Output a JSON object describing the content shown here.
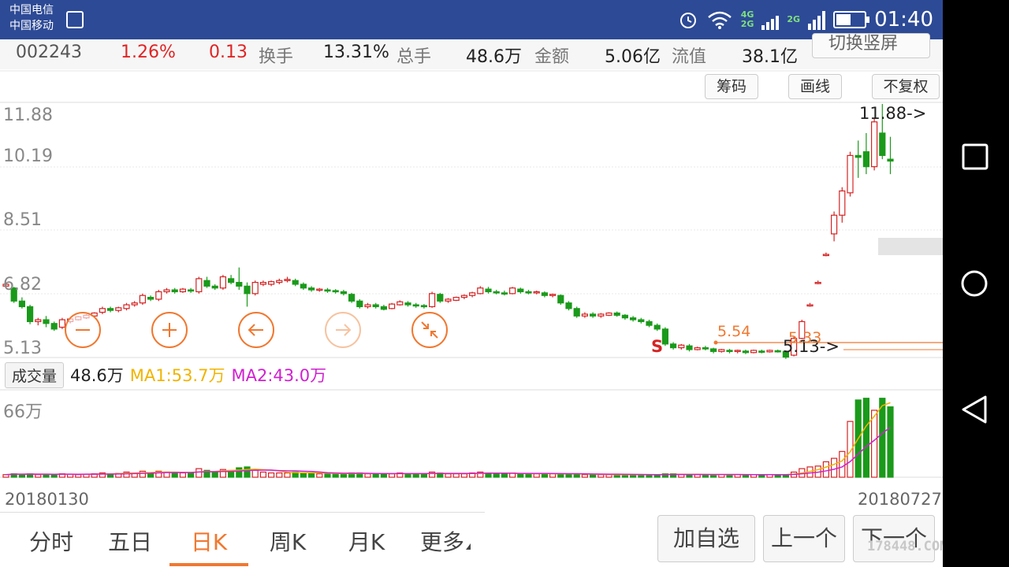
{
  "status_bar": {
    "carrier_1": "中国电信",
    "carrier_2": "中国移动",
    "net_1": "4G",
    "net_2": "2G",
    "net_3": "2G",
    "time": "01:40"
  },
  "quote": {
    "code": "002243",
    "change_pct": "1.26%",
    "change": "0.13",
    "turnover_label": "换手",
    "turnover": "13.31%",
    "volume_label": "总手",
    "volume": "48.6万",
    "amount_label": "金额",
    "amount": "5.06亿",
    "float_label": "流值",
    "float_value": "38.1亿",
    "switch_button": "切换竖屏"
  },
  "toolbar": {
    "chips": "筹码",
    "draw": "画线",
    "adjust": "不复权"
  },
  "chart": {
    "y_ticks": [
      "11.88",
      "10.19",
      "8.51",
      "6.82",
      "5.13"
    ],
    "high_marker": "11.88->",
    "low_marker": "5.13->",
    "avg_label_1": "5.54",
    "avg_label_2": "5.33",
    "signal": "S"
  },
  "volume_header": {
    "tag": "成交量",
    "value": "48.6万",
    "ma1": "MA1:53.7万",
    "ma2": "MA2:43.0万",
    "max_label": "66万"
  },
  "dates": {
    "start": "20180130",
    "end": "20180727"
  },
  "tabs": [
    "分时",
    "五日",
    "日K",
    "周K",
    "月K",
    "更多"
  ],
  "active_tab": "日K",
  "buttons": {
    "add_watch": "加自选",
    "prev": "上一个",
    "next": "下一个"
  },
  "watermark": "178448.COM",
  "colors": {
    "up": "#d42424",
    "down": "#1a9a1a",
    "accent": "#f07830",
    "status_bar": "#2d4a96",
    "ma1": "#f0b400",
    "ma2": "#d020d0"
  },
  "chart_data": {
    "type": "candlestick",
    "y_range": [
      5.13,
      11.88
    ],
    "volume_max": "66万",
    "price_axis": [
      5.13,
      6.82,
      8.51,
      10.19,
      11.88
    ],
    "candles": [
      [
        7.0,
        7.1,
        7.05,
        6.95
      ],
      [
        6.95,
        6.98,
        6.6,
        6.55
      ],
      [
        6.6,
        6.7,
        6.45,
        6.4
      ],
      [
        6.45,
        6.5,
        6.05,
        5.98
      ],
      [
        6.05,
        6.15,
        6.1,
        5.95
      ],
      [
        6.1,
        6.2,
        6.0,
        5.9
      ],
      [
        6.0,
        6.05,
        5.85,
        5.8
      ],
      [
        5.9,
        6.15,
        6.1,
        5.85
      ],
      [
        6.05,
        6.15,
        6.12,
        6.0
      ],
      [
        6.1,
        6.2,
        6.18,
        6.08
      ],
      [
        6.15,
        6.25,
        6.22,
        6.12
      ],
      [
        6.2,
        6.3,
        6.28,
        6.15
      ],
      [
        6.3,
        6.45,
        6.4,
        6.25
      ],
      [
        6.4,
        6.45,
        6.35,
        6.3
      ],
      [
        6.35,
        6.45,
        6.42,
        6.3
      ],
      [
        6.4,
        6.55,
        6.5,
        6.35
      ],
      [
        6.5,
        6.6,
        6.55,
        6.45
      ],
      [
        6.55,
        6.8,
        6.75,
        6.5
      ],
      [
        6.7,
        6.75,
        6.65,
        6.6
      ],
      [
        6.65,
        6.9,
        6.85,
        6.6
      ],
      [
        6.85,
        6.95,
        6.9,
        6.8
      ],
      [
        6.9,
        6.95,
        6.85,
        6.8
      ],
      [
        6.85,
        6.95,
        6.92,
        6.82
      ],
      [
        6.9,
        6.95,
        6.88,
        6.82
      ],
      [
        6.85,
        7.25,
        7.2,
        6.8
      ],
      [
        7.15,
        7.25,
        7.0,
        6.95
      ],
      [
        7.0,
        7.05,
        6.95,
        6.9
      ],
      [
        6.95,
        7.3,
        7.25,
        6.9
      ],
      [
        7.2,
        7.3,
        7.1,
        7.05
      ],
      [
        7.1,
        7.5,
        7.0,
        6.9
      ],
      [
        7.0,
        7.1,
        6.8,
        6.45
      ],
      [
        6.8,
        7.15,
        7.1,
        6.75
      ],
      [
        7.05,
        7.15,
        7.1,
        7.0
      ],
      [
        7.05,
        7.15,
        7.12,
        7.0
      ],
      [
        7.1,
        7.2,
        7.15,
        7.05
      ],
      [
        7.15,
        7.25,
        7.18,
        7.1
      ],
      [
        7.15,
        7.2,
        7.05,
        7.0
      ],
      [
        7.05,
        7.1,
        6.95,
        6.9
      ],
      [
        6.95,
        7.0,
        6.9,
        6.85
      ],
      [
        6.9,
        6.95,
        6.92,
        6.85
      ],
      [
        6.9,
        6.95,
        6.88,
        6.82
      ],
      [
        6.88,
        6.92,
        6.85,
        6.8
      ],
      [
        6.85,
        6.9,
        6.8,
        6.75
      ],
      [
        6.78,
        6.82,
        6.6,
        6.55
      ],
      [
        6.6,
        6.65,
        6.45,
        6.4
      ],
      [
        6.45,
        6.55,
        6.5,
        6.4
      ],
      [
        6.5,
        6.55,
        6.45,
        6.4
      ],
      [
        6.45,
        6.5,
        6.38,
        6.35
      ],
      [
        6.4,
        6.55,
        6.52,
        6.38
      ],
      [
        6.5,
        6.62,
        6.58,
        6.48
      ],
      [
        6.55,
        6.6,
        6.5,
        6.45
      ],
      [
        6.5,
        6.55,
        6.48,
        6.42
      ],
      [
        6.48,
        6.52,
        6.45,
        6.4
      ],
      [
        6.45,
        6.85,
        6.8,
        6.42
      ],
      [
        6.78,
        6.82,
        6.6,
        6.55
      ],
      [
        6.6,
        6.68,
        6.65,
        6.55
      ],
      [
        6.62,
        6.72,
        6.7,
        6.6
      ],
      [
        6.7,
        6.78,
        6.75,
        6.65
      ],
      [
        6.75,
        6.85,
        6.82,
        6.7
      ],
      [
        6.8,
        7.0,
        6.95,
        6.78
      ],
      [
        6.92,
        6.98,
        6.85,
        6.8
      ],
      [
        6.85,
        6.9,
        6.82,
        6.78
      ],
      [
        6.82,
        6.88,
        6.8,
        6.75
      ],
      [
        6.8,
        6.98,
        6.95,
        6.78
      ],
      [
        6.92,
        6.96,
        6.85,
        6.8
      ],
      [
        6.85,
        6.9,
        6.82,
        6.78
      ],
      [
        6.82,
        6.88,
        6.85,
        6.78
      ],
      [
        6.82,
        6.86,
        6.75,
        6.7
      ],
      [
        6.75,
        6.8,
        6.78,
        6.7
      ],
      [
        6.75,
        6.78,
        6.55,
        6.5
      ],
      [
        6.55,
        6.6,
        6.4,
        6.35
      ],
      [
        6.4,
        6.45,
        6.2,
        6.15
      ],
      [
        6.2,
        6.3,
        6.25,
        6.15
      ],
      [
        6.25,
        6.3,
        6.2,
        6.15
      ],
      [
        6.2,
        6.28,
        6.25,
        6.15
      ],
      [
        6.22,
        6.3,
        6.28,
        6.2
      ],
      [
        6.28,
        6.32,
        6.22,
        6.18
      ],
      [
        6.22,
        6.25,
        6.15,
        6.1
      ],
      [
        6.15,
        6.2,
        6.1,
        6.05
      ],
      [
        6.1,
        6.15,
        6.05,
        6.0
      ],
      [
        6.05,
        6.1,
        5.95,
        5.9
      ],
      [
        5.95,
        6.0,
        5.85,
        5.8
      ],
      [
        5.85,
        5.9,
        5.45,
        5.4
      ],
      [
        5.45,
        5.5,
        5.35,
        5.3
      ],
      [
        5.35,
        5.45,
        5.42,
        5.3
      ],
      [
        5.4,
        5.45,
        5.3,
        5.25
      ],
      [
        5.3,
        5.38,
        5.35,
        5.28
      ],
      [
        5.35,
        5.4,
        5.32,
        5.28
      ],
      [
        5.32,
        5.35,
        5.25,
        5.2
      ],
      [
        5.25,
        5.32,
        5.3,
        5.22
      ],
      [
        5.28,
        5.32,
        5.25,
        5.2
      ],
      [
        5.25,
        5.3,
        5.28,
        5.2
      ],
      [
        5.26,
        5.3,
        5.22,
        5.18
      ],
      [
        5.22,
        5.3,
        5.28,
        5.2
      ],
      [
        5.26,
        5.3,
        5.24,
        5.2
      ],
      [
        5.24,
        5.3,
        5.28,
        5.22
      ],
      [
        5.27,
        5.3,
        5.25,
        5.22
      ],
      [
        5.25,
        5.28,
        5.1,
        5.05
      ],
      [
        5.15,
        5.65,
        5.6,
        5.12
      ],
      [
        5.6,
        6.1,
        6.05,
        5.58
      ],
      [
        6.5,
        6.55,
        6.5,
        6.45
      ],
      [
        7.1,
        7.15,
        7.1,
        7.05
      ],
      [
        7.85,
        7.9,
        7.85,
        7.8
      ],
      [
        8.4,
        9.0,
        8.9,
        8.2
      ],
      [
        8.9,
        9.65,
        9.55,
        8.7
      ],
      [
        9.5,
        10.6,
        10.5,
        9.4
      ],
      [
        10.5,
        10.9,
        10.45,
        9.9
      ],
      [
        10.6,
        11.1,
        10.2,
        10.0
      ],
      [
        10.2,
        11.5,
        11.4,
        10.1
      ],
      [
        11.1,
        11.88,
        10.5,
        10.4
      ],
      [
        10.4,
        11.0,
        10.35,
        10.0
      ]
    ],
    "volumes": [
      0.03,
      0.04,
      0.035,
      0.04,
      0.03,
      0.035,
      0.03,
      0.04,
      0.035,
      0.03,
      0.035,
      0.04,
      0.05,
      0.04,
      0.045,
      0.06,
      0.05,
      0.07,
      0.05,
      0.07,
      0.06,
      0.05,
      0.05,
      0.05,
      0.1,
      0.08,
      0.06,
      0.09,
      0.07,
      0.11,
      0.12,
      0.08,
      0.06,
      0.05,
      0.05,
      0.05,
      0.06,
      0.05,
      0.05,
      0.04,
      0.04,
      0.04,
      0.04,
      0.05,
      0.05,
      0.04,
      0.04,
      0.04,
      0.04,
      0.05,
      0.04,
      0.04,
      0.04,
      0.06,
      0.05,
      0.04,
      0.04,
      0.04,
      0.05,
      0.06,
      0.05,
      0.04,
      0.04,
      0.05,
      0.04,
      0.04,
      0.04,
      0.04,
      0.04,
      0.04,
      0.04,
      0.04,
      0.03,
      0.03,
      0.03,
      0.03,
      0.03,
      0.03,
      0.03,
      0.03,
      0.03,
      0.03,
      0.04,
      0.04,
      0.03,
      0.03,
      0.03,
      0.03,
      0.03,
      0.03,
      0.03,
      0.03,
      0.03,
      0.03,
      0.03,
      0.03,
      0.03,
      0.03,
      0.06,
      0.1,
      0.12,
      0.13,
      0.18,
      0.22,
      0.3,
      0.65,
      0.9,
      0.92,
      0.78,
      0.92,
      0.82
    ],
    "ma1": "MA1:53.7万",
    "ma2": "MA2:43.0万"
  }
}
